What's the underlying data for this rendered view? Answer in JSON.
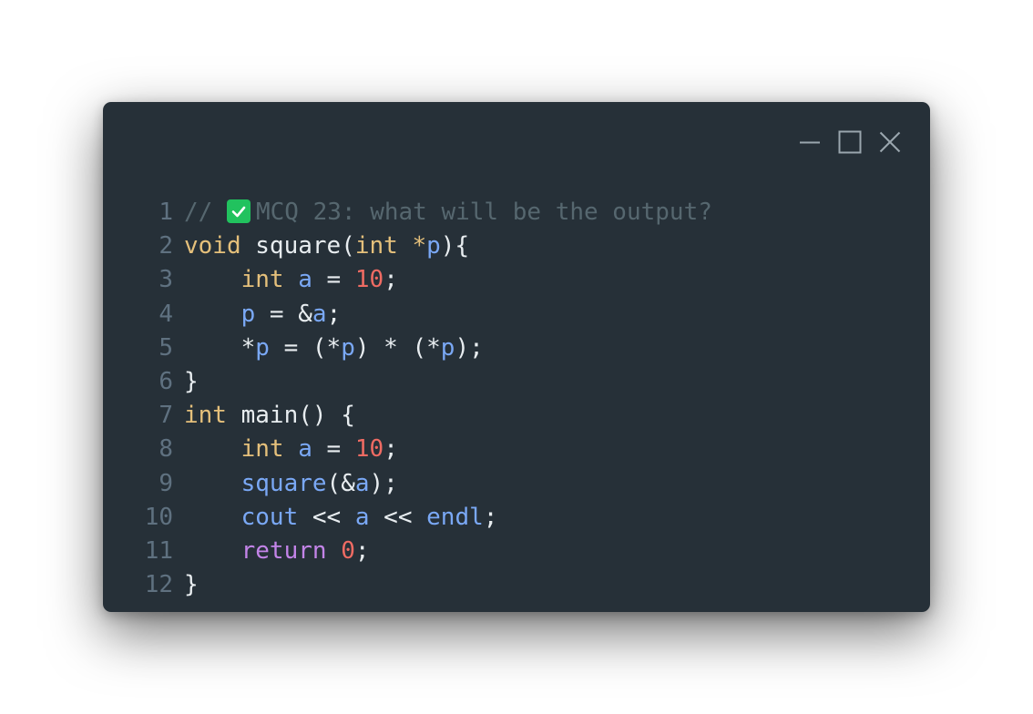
{
  "window": {
    "controls": [
      "minimize-icon",
      "maximize-icon",
      "close-icon"
    ]
  },
  "colors": {
    "background": "#263038",
    "comment": "#56676f",
    "type": "#e5c07b",
    "variable": "#7aa8f5",
    "number": "#ef6b63",
    "keyword": "#c384e8",
    "text": "#e8edf0",
    "line_number": "#5f7180",
    "check_badge": "#21c25e"
  },
  "code": {
    "lines": [
      {
        "n": "1",
        "tokens": [
          {
            "t": "// ",
            "c": "comment"
          },
          {
            "icon": "check-icon"
          },
          {
            "t": "MCQ 23: what will be the output?",
            "c": "comment"
          }
        ]
      },
      {
        "n": "2",
        "tokens": [
          {
            "t": "void",
            "c": "type"
          },
          {
            "t": " square(",
            "c": "punct"
          },
          {
            "t": "int",
            "c": "type"
          },
          {
            "t": " ",
            "c": "punct"
          },
          {
            "t": "*",
            "c": "type"
          },
          {
            "t": "p",
            "c": "var"
          },
          {
            "t": "){",
            "c": "punct"
          }
        ]
      },
      {
        "n": "3",
        "tokens": [
          {
            "t": "    ",
            "c": "punct"
          },
          {
            "t": "int",
            "c": "type"
          },
          {
            "t": " ",
            "c": "punct"
          },
          {
            "t": "a",
            "c": "var"
          },
          {
            "t": " = ",
            "c": "punct"
          },
          {
            "t": "10",
            "c": "num"
          },
          {
            "t": ";",
            "c": "punct"
          }
        ]
      },
      {
        "n": "4",
        "tokens": [
          {
            "t": "    ",
            "c": "punct"
          },
          {
            "t": "p",
            "c": "var"
          },
          {
            "t": " = &",
            "c": "punct"
          },
          {
            "t": "a",
            "c": "var"
          },
          {
            "t": ";",
            "c": "punct"
          }
        ]
      },
      {
        "n": "5",
        "tokens": [
          {
            "t": "    *",
            "c": "punct"
          },
          {
            "t": "p",
            "c": "var"
          },
          {
            "t": " = (*",
            "c": "punct"
          },
          {
            "t": "p",
            "c": "var"
          },
          {
            "t": ") * (*",
            "c": "punct"
          },
          {
            "t": "p",
            "c": "var"
          },
          {
            "t": ");",
            "c": "punct"
          }
        ]
      },
      {
        "n": "6",
        "tokens": [
          {
            "t": "}",
            "c": "punct"
          }
        ]
      },
      {
        "n": "7",
        "tokens": [
          {
            "t": "int",
            "c": "type"
          },
          {
            "t": " main() {",
            "c": "punct"
          }
        ]
      },
      {
        "n": "8",
        "tokens": [
          {
            "t": "    ",
            "c": "punct"
          },
          {
            "t": "int",
            "c": "type"
          },
          {
            "t": " ",
            "c": "punct"
          },
          {
            "t": "a",
            "c": "var"
          },
          {
            "t": " = ",
            "c": "punct"
          },
          {
            "t": "10",
            "c": "num"
          },
          {
            "t": ";",
            "c": "punct"
          }
        ]
      },
      {
        "n": "9",
        "tokens": [
          {
            "t": "    ",
            "c": "punct"
          },
          {
            "t": "square",
            "c": "var"
          },
          {
            "t": "(&",
            "c": "punct"
          },
          {
            "t": "a",
            "c": "var"
          },
          {
            "t": ");",
            "c": "punct"
          }
        ]
      },
      {
        "n": "10",
        "tokens": [
          {
            "t": "    ",
            "c": "punct"
          },
          {
            "t": "cout",
            "c": "var"
          },
          {
            "t": " << ",
            "c": "punct"
          },
          {
            "t": "a",
            "c": "var"
          },
          {
            "t": " << ",
            "c": "punct"
          },
          {
            "t": "endl",
            "c": "var"
          },
          {
            "t": ";",
            "c": "punct"
          }
        ]
      },
      {
        "n": "11",
        "tokens": [
          {
            "t": "    ",
            "c": "punct"
          },
          {
            "t": "return",
            "c": "kw"
          },
          {
            "t": " ",
            "c": "punct"
          },
          {
            "t": "0",
            "c": "num"
          },
          {
            "t": ";",
            "c": "punct"
          }
        ]
      },
      {
        "n": "12",
        "tokens": [
          {
            "t": "}",
            "c": "punct"
          }
        ]
      }
    ]
  }
}
